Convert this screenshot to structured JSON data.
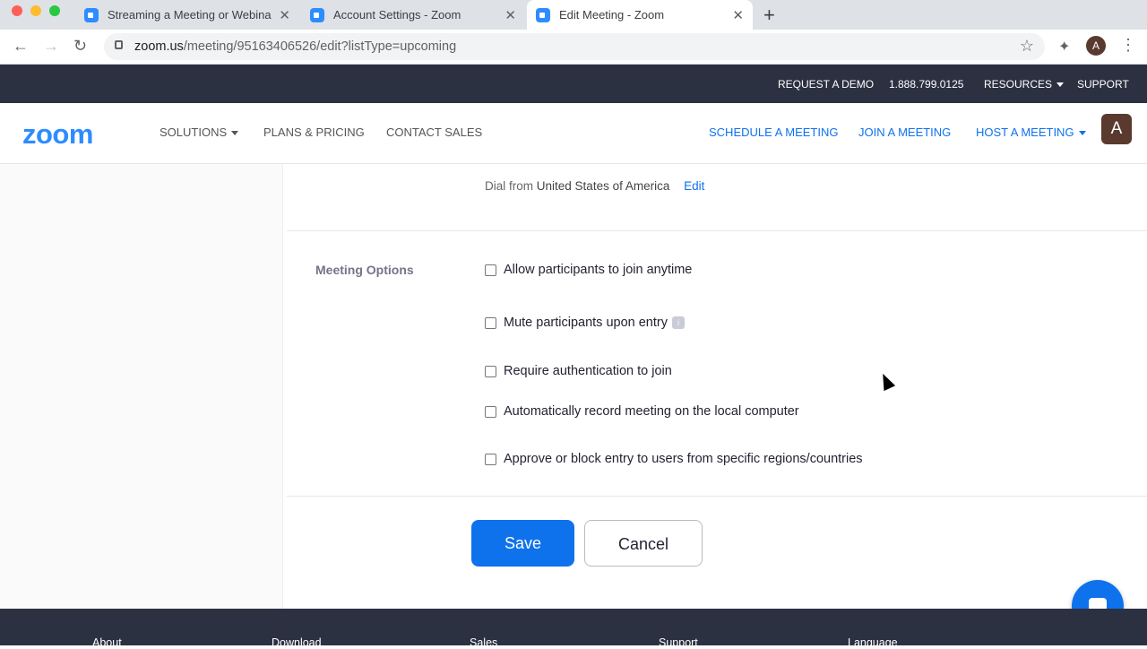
{
  "browser": {
    "tabs": [
      {
        "title": "Streaming a Meeting or Webinar"
      },
      {
        "title": "Account Settings - Zoom"
      },
      {
        "title": "Edit Meeting - Zoom"
      }
    ],
    "url_host": "zoom.us",
    "url_path": "/meeting/95163406526/edit?listType=upcoming",
    "profile_initial": "A"
  },
  "topbar": {
    "request_demo": "REQUEST A DEMO",
    "phone": "1.888.799.0125",
    "resources": "RESOURCES",
    "support": "SUPPORT"
  },
  "header": {
    "logo": "zoom",
    "solutions": "SOLUTIONS",
    "plans": "PLANS & PRICING",
    "contact": "CONTACT SALES",
    "schedule": "SCHEDULE A MEETING",
    "join": "JOIN A MEETING",
    "host": "HOST A MEETING",
    "avatar": "A"
  },
  "audio": {
    "dial_prefix": "Dial from",
    "country": "United States of America",
    "edit": "Edit"
  },
  "meeting_options": {
    "label": "Meeting Options",
    "options": [
      {
        "label": "Allow participants to join anytime",
        "checked": false
      },
      {
        "label": "Mute participants upon entry",
        "checked": false
      },
      {
        "label": "Require authentication to join",
        "checked": false
      },
      {
        "label": "Automatically record meeting on the local computer",
        "checked": false
      },
      {
        "label": "Approve or block entry to users from specific regions/countries",
        "checked": false
      }
    ]
  },
  "actions": {
    "save": "Save",
    "cancel": "Cancel"
  },
  "footer": {
    "columns": [
      "About",
      "Download",
      "Sales",
      "Support",
      "Language"
    ]
  },
  "colors": {
    "brand": "#2d8cff",
    "primary_button": "#0e72ed",
    "dark_bar": "#2c3142"
  }
}
